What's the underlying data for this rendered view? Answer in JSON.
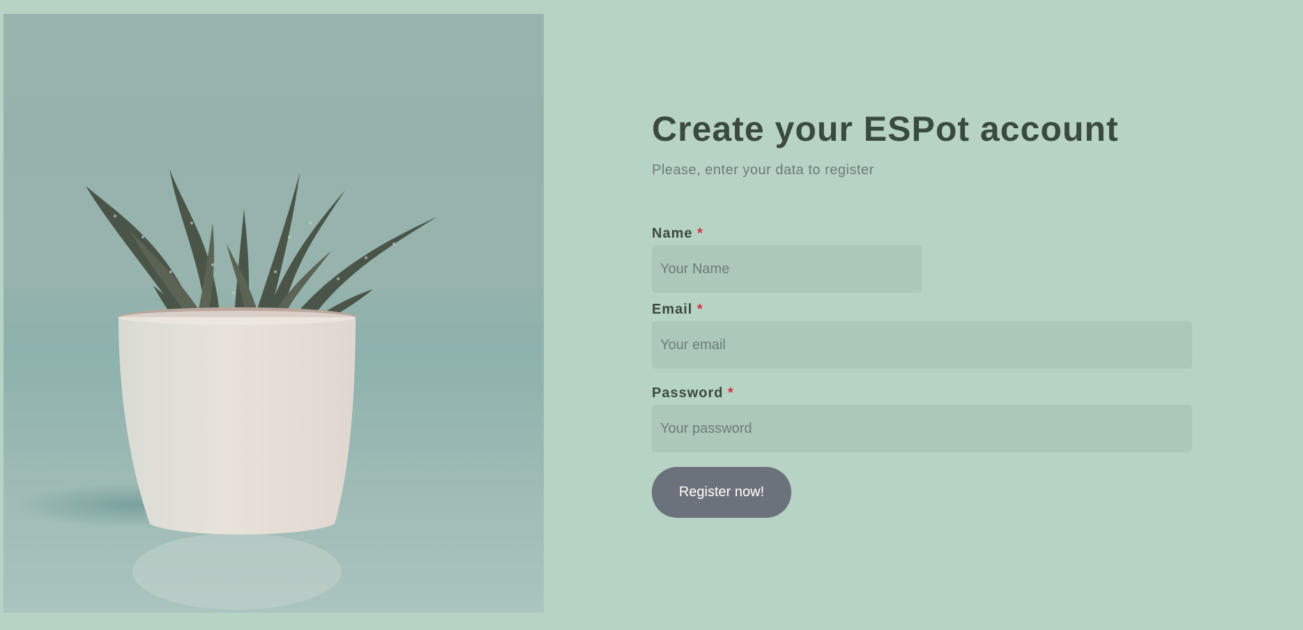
{
  "hero_image": {
    "alt": "Potted succulent plant"
  },
  "form": {
    "title": "Create your ESPot account",
    "subtitle": "Please, enter your data to register",
    "name": {
      "label": "Name",
      "required_mark": "*",
      "placeholder": "Your Name",
      "value": ""
    },
    "email": {
      "label": "Email",
      "required_mark": "*",
      "placeholder": "Your email",
      "value": ""
    },
    "password": {
      "label": "Password",
      "required_mark": "*",
      "placeholder": "Your password",
      "value": ""
    },
    "submit_label": "Register now!"
  },
  "colors": {
    "page_background": "#b7d3c3",
    "input_background": "#abc8b8",
    "heading_text": "#3a4b3e",
    "required_asterisk": "#d2334a",
    "button_background": "#6c727b"
  }
}
